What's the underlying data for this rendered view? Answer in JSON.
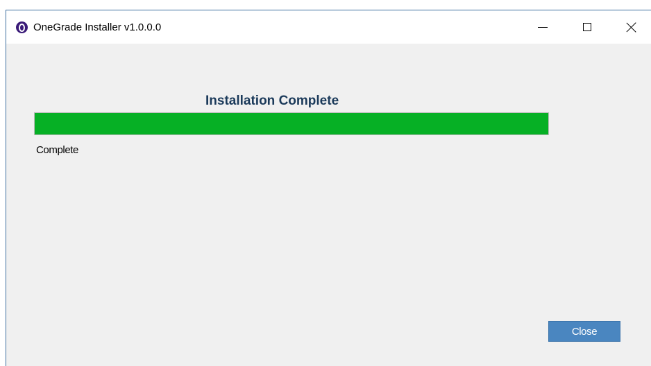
{
  "window": {
    "title": "OneGrade Installer v1.0.0.0",
    "app_icon": "onegrade-logo-icon",
    "controls": {
      "minimize_icon": "minimize-icon",
      "maximize_icon": "maximize-icon",
      "close_icon": "close-icon"
    }
  },
  "main": {
    "heading": "Installation Complete",
    "progress": {
      "value_percent": 100,
      "color": "#06b025"
    },
    "status_text": "Complete"
  },
  "footer": {
    "close_label": "Close",
    "close_color": "#4a86c0"
  }
}
